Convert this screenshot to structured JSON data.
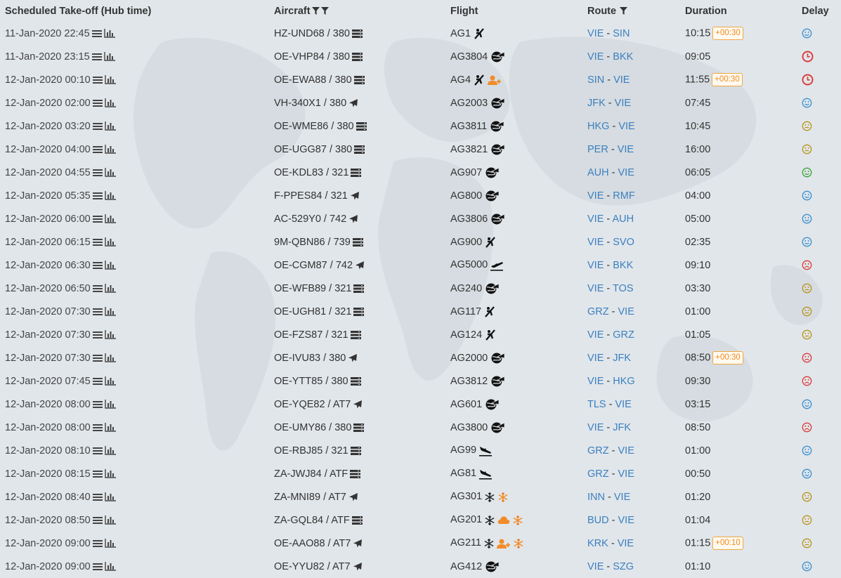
{
  "headers": {
    "takeoff": "Scheduled Take-off (Hub time)",
    "aircraft": "Aircraft",
    "flight": "Flight",
    "route": "Route",
    "duration": "Duration",
    "delay": "Delay"
  },
  "colors": {
    "link": "#3b7fbf",
    "badge": "#f08a1e",
    "weather": "#f28c2a",
    "delay_ok": "#3b8fcf",
    "delay_good": "#3aa13a",
    "delay_neutral": "#b8941c",
    "delay_bad": "#d93b3b"
  },
  "rows": [
    {
      "takeoff": "11-Jan-2020 22:45",
      "aircraft": "HZ-UND68 / 380",
      "aircraft_icon": "server-icon",
      "flight": "AG1",
      "flight_icons": [
        "takeoff-runway-icon"
      ],
      "route_from": "VIE",
      "route_to": "SIN",
      "duration": "10:15",
      "badge": "+00:30",
      "delay": "smile-blue"
    },
    {
      "takeoff": "11-Jan-2020 23:15",
      "aircraft": "OE-VHP84 / 380",
      "aircraft_icon": "server-icon",
      "flight": "AG3804",
      "flight_icons": [
        "globe-plane-icon"
      ],
      "route_from": "VIE",
      "route_to": "BKK",
      "duration": "09:05",
      "badge": "",
      "delay": "clock-red"
    },
    {
      "takeoff": "12-Jan-2020 00:10",
      "aircraft": "OE-EWA88 / 380",
      "aircraft_icon": "server-icon",
      "flight": "AG4",
      "flight_icons": [
        "takeoff-runway-icon",
        "user-plus-icon"
      ],
      "route_from": "SIN",
      "route_to": "VIE",
      "duration": "11:55",
      "badge": "+00:30",
      "delay": "clock-red"
    },
    {
      "takeoff": "12-Jan-2020 02:00",
      "aircraft": "VH-340X1 / 380",
      "aircraft_icon": "plane-icon",
      "flight": "AG2003",
      "flight_icons": [
        "globe-plane-icon"
      ],
      "route_from": "JFK",
      "route_to": "VIE",
      "duration": "07:45",
      "badge": "",
      "delay": "smile-blue"
    },
    {
      "takeoff": "12-Jan-2020 03:20",
      "aircraft": "OE-WME86 / 380",
      "aircraft_icon": "server-icon",
      "flight": "AG3811",
      "flight_icons": [
        "globe-plane-icon"
      ],
      "route_from": "HKG",
      "route_to": "VIE",
      "duration": "10:45",
      "badge": "",
      "delay": "meh-yellow"
    },
    {
      "takeoff": "12-Jan-2020 04:00",
      "aircraft": "OE-UGG87 / 380",
      "aircraft_icon": "server-icon",
      "flight": "AG3821",
      "flight_icons": [
        "globe-plane-icon"
      ],
      "route_from": "PER",
      "route_to": "VIE",
      "duration": "16:00",
      "badge": "",
      "delay": "meh-yellow"
    },
    {
      "takeoff": "12-Jan-2020 04:55",
      "aircraft": "OE-KDL83 / 321",
      "aircraft_icon": "server-icon",
      "flight": "AG907",
      "flight_icons": [
        "globe-plane-icon"
      ],
      "route_from": "AUH",
      "route_to": "VIE",
      "duration": "06:05",
      "badge": "",
      "delay": "smile-green"
    },
    {
      "takeoff": "12-Jan-2020 05:35",
      "aircraft": "F-PPES84 / 321",
      "aircraft_icon": "plane-icon",
      "flight": "AG800",
      "flight_icons": [
        "globe-plane-icon"
      ],
      "route_from": "VIE",
      "route_to": "RMF",
      "duration": "04:00",
      "badge": "",
      "delay": "smile-blue"
    },
    {
      "takeoff": "12-Jan-2020 06:00",
      "aircraft": "AC-529Y0 / 742",
      "aircraft_icon": "plane-icon",
      "flight": "AG3806",
      "flight_icons": [
        "globe-plane-icon"
      ],
      "route_from": "VIE",
      "route_to": "AUH",
      "duration": "05:00",
      "badge": "",
      "delay": "smile-blue"
    },
    {
      "takeoff": "12-Jan-2020 06:15",
      "aircraft": "9M-QBN86 / 739",
      "aircraft_icon": "server-icon",
      "flight": "AG900",
      "flight_icons": [
        "takeoff-runway-icon"
      ],
      "route_from": "VIE",
      "route_to": "SVO",
      "duration": "02:35",
      "badge": "",
      "delay": "smile-blue"
    },
    {
      "takeoff": "12-Jan-2020 06:30",
      "aircraft": "OE-CGM87 / 742",
      "aircraft_icon": "plane-icon",
      "flight": "AG5000",
      "flight_icons": [
        "plane-departure-icon"
      ],
      "route_from": "VIE",
      "route_to": "BKK",
      "duration": "09:10",
      "badge": "",
      "delay": "frown-red"
    },
    {
      "takeoff": "12-Jan-2020 06:50",
      "aircraft": "OE-WFB89 / 321",
      "aircraft_icon": "server-icon",
      "flight": "AG240",
      "flight_icons": [
        "globe-plane-icon"
      ],
      "route_from": "VIE",
      "route_to": "TOS",
      "duration": "03:30",
      "badge": "",
      "delay": "meh-yellow"
    },
    {
      "takeoff": "12-Jan-2020 07:30",
      "aircraft": "OE-UGH81 / 321",
      "aircraft_icon": "server-icon",
      "flight": "AG117",
      "flight_icons": [
        "takeoff-runway-icon"
      ],
      "route_from": "GRZ",
      "route_to": "VIE",
      "duration": "01:00",
      "badge": "",
      "delay": "meh-yellow"
    },
    {
      "takeoff": "12-Jan-2020 07:30",
      "aircraft": "OE-FZS87 / 321",
      "aircraft_icon": "server-icon",
      "flight": "AG124",
      "flight_icons": [
        "takeoff-runway-icon"
      ],
      "route_from": "VIE",
      "route_to": "GRZ",
      "duration": "01:05",
      "badge": "",
      "delay": "meh-yellow"
    },
    {
      "takeoff": "12-Jan-2020 07:30",
      "aircraft": "OE-IVU83 / 380",
      "aircraft_icon": "plane-icon",
      "flight": "AG2000",
      "flight_icons": [
        "globe-plane-icon"
      ],
      "route_from": "VIE",
      "route_to": "JFK",
      "duration": "08:50",
      "badge": "+00:30",
      "delay": "frown-red"
    },
    {
      "takeoff": "12-Jan-2020 07:45",
      "aircraft": "OE-YTT85 / 380",
      "aircraft_icon": "server-icon",
      "flight": "AG3812",
      "flight_icons": [
        "globe-plane-icon"
      ],
      "route_from": "VIE",
      "route_to": "HKG",
      "duration": "09:30",
      "badge": "",
      "delay": "frown-red"
    },
    {
      "takeoff": "12-Jan-2020 08:00",
      "aircraft": "OE-YQE82 / AT7",
      "aircraft_icon": "plane-icon",
      "flight": "AG601",
      "flight_icons": [
        "globe-plane-icon"
      ],
      "route_from": "TLS",
      "route_to": "VIE",
      "duration": "03:15",
      "badge": "",
      "delay": "smile-blue"
    },
    {
      "takeoff": "12-Jan-2020 08:00",
      "aircraft": "OE-UMY86 / 380",
      "aircraft_icon": "server-icon",
      "flight": "AG3800",
      "flight_icons": [
        "globe-plane-icon"
      ],
      "route_from": "VIE",
      "route_to": "JFK",
      "duration": "08:50",
      "badge": "",
      "delay": "frown-red"
    },
    {
      "takeoff": "12-Jan-2020 08:10",
      "aircraft": "OE-RBJ85 / 321",
      "aircraft_icon": "server-icon",
      "flight": "AG99",
      "flight_icons": [
        "plane-landing-icon"
      ],
      "route_from": "GRZ",
      "route_to": "VIE",
      "duration": "01:00",
      "badge": "",
      "delay": "smile-blue"
    },
    {
      "takeoff": "12-Jan-2020 08:15",
      "aircraft": "ZA-JWJ84 / ATF",
      "aircraft_icon": "server-icon",
      "flight": "AG81",
      "flight_icons": [
        "plane-landing-icon"
      ],
      "route_from": "GRZ",
      "route_to": "VIE",
      "duration": "00:50",
      "badge": "",
      "delay": "smile-blue"
    },
    {
      "takeoff": "12-Jan-2020 08:40",
      "aircraft": "ZA-MNI89 / AT7",
      "aircraft_icon": "plane-icon",
      "flight": "AG301",
      "flight_icons": [
        "snowflake-icon",
        "snowflake-orange-icon"
      ],
      "route_from": "INN",
      "route_to": "VIE",
      "duration": "01:20",
      "badge": "",
      "delay": "meh-yellow"
    },
    {
      "takeoff": "12-Jan-2020 08:50",
      "aircraft": "ZA-GQL84 / ATF",
      "aircraft_icon": "server-icon",
      "flight": "AG201",
      "flight_icons": [
        "snowflake-icon",
        "cloud-orange-icon",
        "snowflake-orange-icon"
      ],
      "route_from": "BUD",
      "route_to": "VIE",
      "duration": "01:04",
      "badge": "",
      "delay": "meh-yellow"
    },
    {
      "takeoff": "12-Jan-2020 09:00",
      "aircraft": "OE-AAO88 / AT7",
      "aircraft_icon": "plane-icon",
      "flight": "AG211",
      "flight_icons": [
        "snowflake-icon",
        "user-plus-icon",
        "snowflake-orange-icon"
      ],
      "route_from": "KRK",
      "route_to": "VIE",
      "duration": "01:15",
      "badge": "+00:10",
      "delay": "meh-yellow"
    },
    {
      "takeoff": "12-Jan-2020 09:00",
      "aircraft": "OE-YYU82 / AT7",
      "aircraft_icon": "plane-icon",
      "flight": "AG412",
      "flight_icons": [
        "globe-plane-icon"
      ],
      "route_from": "VIE",
      "route_to": "SZG",
      "duration": "01:10",
      "badge": "",
      "delay": "smile-blue"
    }
  ]
}
